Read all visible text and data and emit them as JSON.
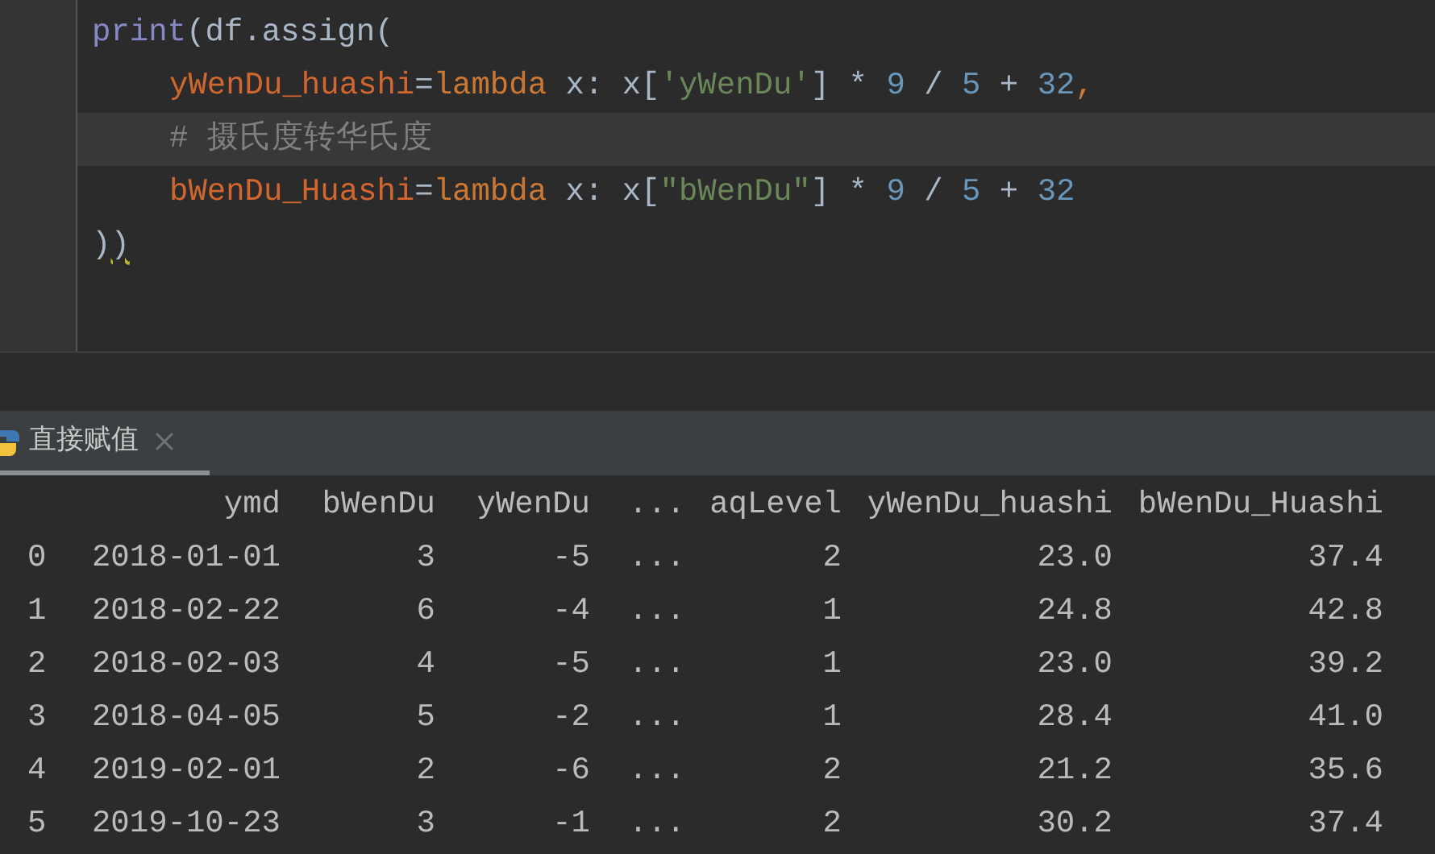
{
  "editor": {
    "lines": [
      {
        "indent": false,
        "current": false,
        "tokens": [
          {
            "kind": "builtin",
            "text": "print"
          },
          {
            "kind": "plain",
            "text": "(df.assign("
          }
        ]
      },
      {
        "indent": true,
        "current": false,
        "tokens": [
          {
            "kind": "param",
            "text": "yWenDu_huashi"
          },
          {
            "kind": "plain",
            "text": "="
          },
          {
            "kind": "keyword",
            "text": "lambda"
          },
          {
            "kind": "plain",
            "text": " x: x["
          },
          {
            "kind": "string",
            "text": "'yWenDu'"
          },
          {
            "kind": "plain",
            "text": "] * "
          },
          {
            "kind": "number",
            "text": "9"
          },
          {
            "kind": "plain",
            "text": " / "
          },
          {
            "kind": "number",
            "text": "5"
          },
          {
            "kind": "plain",
            "text": " + "
          },
          {
            "kind": "number",
            "text": "32"
          },
          {
            "kind": "keyword",
            "text": ","
          }
        ]
      },
      {
        "indent": true,
        "current": true,
        "tokens": [
          {
            "kind": "comment",
            "text": "# 摄氏度转华氏度"
          }
        ]
      },
      {
        "indent": true,
        "current": false,
        "tokens": [
          {
            "kind": "param",
            "text": "bWenDu_Huashi"
          },
          {
            "kind": "plain",
            "text": "="
          },
          {
            "kind": "keyword",
            "text": "lambda"
          },
          {
            "kind": "plain",
            "text": " x: x["
          },
          {
            "kind": "string",
            "text": "\"bWenDu\""
          },
          {
            "kind": "plain",
            "text": "] * "
          },
          {
            "kind": "number",
            "text": "9"
          },
          {
            "kind": "plain",
            "text": " / "
          },
          {
            "kind": "number",
            "text": "5"
          },
          {
            "kind": "plain",
            "text": " + "
          },
          {
            "kind": "number",
            "text": "32"
          }
        ]
      },
      {
        "indent": false,
        "current": false,
        "tokens": [
          {
            "kind": "plain",
            "text": ")"
          },
          {
            "kind": "plain",
            "text": ")",
            "warning": true
          }
        ]
      }
    ]
  },
  "run_tab": {
    "label": "直接赋值",
    "selected": true
  },
  "table": {
    "columns": [
      "ymd",
      "bWenDu",
      "yWenDu",
      "...",
      "aqLevel",
      "yWenDu_huashi",
      "bWenDu_Huashi"
    ],
    "rows": [
      {
        "index": "0",
        "cells": [
          "2018-01-01",
          "3",
          "-5",
          "...",
          "2",
          "23.0",
          "37.4"
        ]
      },
      {
        "index": "1",
        "cells": [
          "2018-02-22",
          "6",
          "-4",
          "...",
          "1",
          "24.8",
          "42.8"
        ]
      },
      {
        "index": "2",
        "cells": [
          "2018-02-03",
          "4",
          "-5",
          "...",
          "1",
          "23.0",
          "39.2"
        ]
      },
      {
        "index": "3",
        "cells": [
          "2018-04-05",
          "5",
          "-2",
          "...",
          "1",
          "28.4",
          "41.0"
        ]
      },
      {
        "index": "4",
        "cells": [
          "2019-02-01",
          "2",
          "-6",
          "...",
          "2",
          "21.2",
          "35.6"
        ]
      },
      {
        "index": "5",
        "cells": [
          "2019-10-23",
          "3",
          "-1",
          "...",
          "2",
          "30.2",
          "37.4"
        ]
      }
    ]
  }
}
